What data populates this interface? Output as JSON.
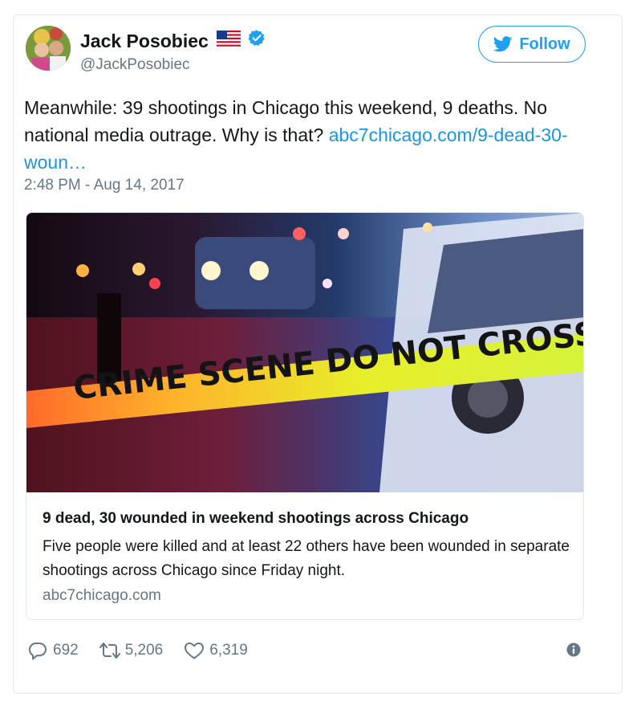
{
  "author": {
    "name": "Jack Posobiec",
    "handle": "@JackPosobiec",
    "flag_icon": "us-flag-icon",
    "verified_icon": "verified-badge-icon"
  },
  "follow_button": {
    "label": "Follow",
    "icon": "twitter-bird-icon",
    "color": "#1da1f2"
  },
  "tweet": {
    "text": "Meanwhile: 39 shootings in Chicago this weekend, 9 deaths. No national media outrage. Why is that? ",
    "link": "abc7chicago.com/9-dead-30-woun…",
    "timestamp": "2:48 PM - Aug 14, 2017"
  },
  "card": {
    "image_tape_text": "CRIME SCENE DO NOT CROSS",
    "title": "9 dead, 30 wounded in weekend shootings across Chicago",
    "description": "Five people were killed and at least 22 others have been wounded in separate shootings across Chicago since Friday night.",
    "domain": "abc7chicago.com"
  },
  "actions": {
    "replies": "692",
    "retweets": "5,206",
    "likes": "6,319"
  },
  "colors": {
    "link": "#1b95e0",
    "secondary_text": "#657786",
    "border": "#e1e8ed"
  }
}
